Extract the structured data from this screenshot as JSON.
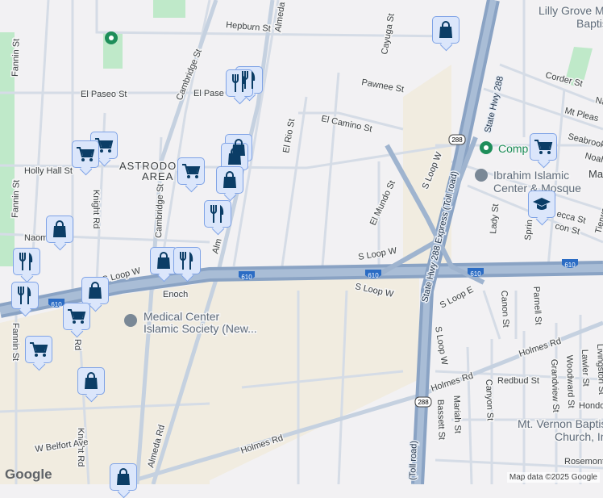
{
  "map": {
    "attribution": "Map data ©2025 Google",
    "logo": "Google",
    "area_label_1": "ASTRODOME",
    "area_label_2": "AREA",
    "streets": {
      "hepburn": "Hepburn St",
      "almeda": "Almeda Rd",
      "almeda2": "Almeda Rd",
      "almeda3": "Alm",
      "cayuga": "Cayuga St",
      "pawnee": "Pawnee St",
      "fannin": "Fannin St",
      "fannin2": "Fannin St",
      "fannin3": "Fannin St",
      "cambridge": "Cambridge St",
      "cambridge2": "Cambridge St",
      "elpaseo": "El Paseo St",
      "elpaseo2": "El Pase",
      "elcamino": "El Camino St",
      "elrio": "El Rio St",
      "hollyhall": "Holly Hall St",
      "knight": "Knight Rd",
      "knight2": "Knight Rd",
      "naom": "Naom",
      "elmundo": "El Mundo St",
      "sloopw1": "S Loop W",
      "sloopw2": "S Loop W",
      "sloopw3": "S Loop W",
      "sloopw4": "S Loop W",
      "sloopw5": "S Loop W",
      "sloope": "S Loop E",
      "hwy288": "State Hwy 288 Express (Toll road)",
      "hwy288b": "State Hwy 288",
      "tollroad": "(Toll road)",
      "corder": "Corder St",
      "mtpleasant": "Mt Pleas",
      "seabrook": "Seabrook",
      "noah": "Noah",
      "ma": "Ma",
      "rebecca": "ecca St",
      "macon": "con St",
      "tierwester": "Tierwester",
      "lady": "Lady St",
      "spring": "Sprin",
      "canon": "Canon St",
      "parnell": "Parnell St",
      "holmes1": "Holmes Rd",
      "holmes2": "Holmes Rd",
      "holmes3": "Holmes Rd",
      "redbud": "Redbud St",
      "bassett": "Bassett St",
      "mariah": "Mariah St",
      "canyon": "Canyon St",
      "grandview": "Grandview St",
      "woodward": "Woodward St",
      "lawler": "Lawler St",
      "livingston": "Livingston St",
      "hondo": "Hondo",
      "rosemont": "Rosemont",
      "wbelfort": "W Belfort Ave",
      "enoch": "Enoch",
      "rd": "Rd",
      "na": "Na"
    },
    "shields": {
      "i610": "610",
      "sh288": "288"
    },
    "pois": {
      "lilly1": "Lilly Grove M",
      "lilly2": "Baptis",
      "gym": "Comp      Gym",
      "ibrahim1": "Ibrahim Islamic",
      "ibrahim2": "Center & Mosque",
      "medical1": "Medical Center",
      "medical2": "Islamic Society (New...",
      "vernon1": "Mt. Vernon Baptis",
      "vernon2": "Church, In"
    },
    "colors": {
      "pin_bg": "#dbe6fb",
      "pin_icon": "#0b3d66",
      "freeway": "#8aa3c4",
      "park": "#bfe9c9"
    }
  }
}
